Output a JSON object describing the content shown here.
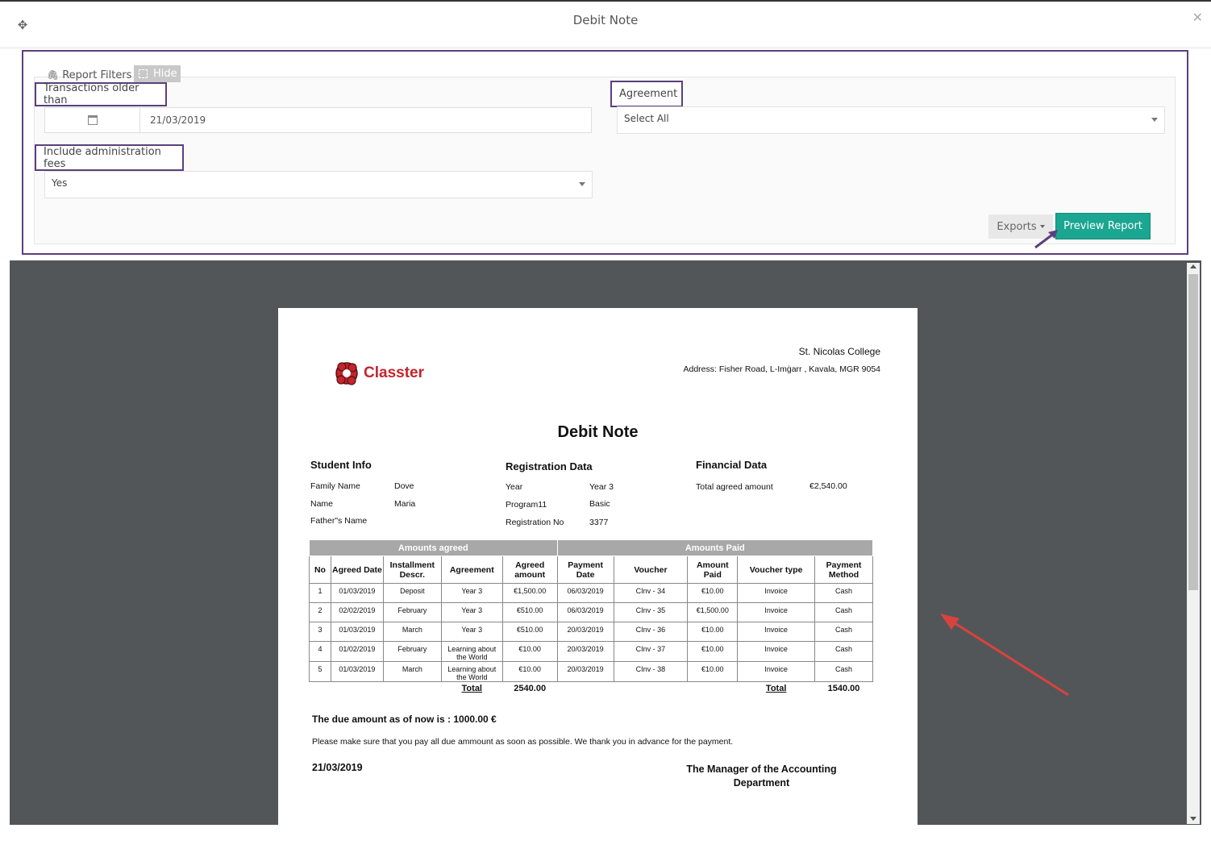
{
  "modal": {
    "title": "Debit Note"
  },
  "filters": {
    "tab_label": "Report Filters",
    "hide_label": "Hide",
    "transactions_label": "Transactions older than",
    "transactions_value": "21/03/2019",
    "agreement_label": "Agreement",
    "agreement_value": "Select All",
    "admin_fees_label": "Include administration fees",
    "admin_fees_value": "Yes",
    "exports_label": "Exports",
    "preview_label": "Preview Report"
  },
  "report": {
    "school": "St. Nicolas College",
    "address": "Address: Fisher Road, L-Imġarr , Kavala, MGR 9054",
    "logo_text": "Classter",
    "title": "Debit Note",
    "student_info": {
      "title": "Student Info",
      "rows": [
        {
          "label": "Family Name",
          "value": "Dove"
        },
        {
          "label": "Name",
          "value": "Maria"
        },
        {
          "label": "Father\"s Name",
          "value": ""
        }
      ]
    },
    "registration_data": {
      "title": "Registration Data",
      "rows": [
        {
          "label": "Year",
          "value": "Year 3"
        },
        {
          "label": "Program11",
          "value": "Basic"
        },
        {
          "label": "Registration No",
          "value": "3377"
        }
      ]
    },
    "financial_data": {
      "title": "Financial Data",
      "rows": [
        {
          "label": "Total agreed amount",
          "value": "€2,540.00"
        }
      ]
    },
    "table": {
      "group_agreed": "Amounts agreed",
      "group_paid": "Amounts Paid",
      "headers": [
        "No",
        "Agreed Date",
        "Installment Descr.",
        "Agreement",
        "Agreed amount",
        "Payment Date",
        "Voucher",
        "Amount Paid",
        "Voucher type",
        "Payment Method"
      ],
      "rows": [
        [
          "1",
          "01/03/2019",
          "Deposit",
          "Year 3",
          "€1,500.00",
          "06/03/2019",
          "CInv - 34",
          "€10.00",
          "Invoice",
          "Cash"
        ],
        [
          "2",
          "02/02/2019",
          "February",
          "Year 3",
          "€510.00",
          "06/03/2019",
          "CInv - 35",
          "€1,500.00",
          "Invoice",
          "Cash"
        ],
        [
          "3",
          "01/03/2019",
          "March",
          "Year 3",
          "€510.00",
          "20/03/2019",
          "CInv - 36",
          "€10.00",
          "Invoice",
          "Cash"
        ],
        [
          "4",
          "01/02/2019",
          "February",
          "Learning about the World",
          "€10.00",
          "20/03/2019",
          "CInv - 37",
          "€10.00",
          "Invoice",
          "Cash"
        ],
        [
          "5",
          "01/03/2019",
          "March",
          "Learning about the World",
          "€10.00",
          "20/03/2019",
          "CInv - 38",
          "€10.00",
          "Invoice",
          "Cash"
        ]
      ],
      "total_label": "Total",
      "total_agreed": "2540.00",
      "total_paid": "1540.00"
    },
    "due_text": "The due amount as of now is : 1000.00 €",
    "notice": "Please make sure that you pay all due ammount as soon as possible. We thank you in advance for the payment.",
    "date": "21/03/2019",
    "manager": "The Manager of the Accounting Department"
  },
  "colors": {
    "accent": "#1aa691",
    "highlight": "#5c3f7e",
    "annotation_arrow": "#d9433d",
    "brand": "#c4242d"
  }
}
